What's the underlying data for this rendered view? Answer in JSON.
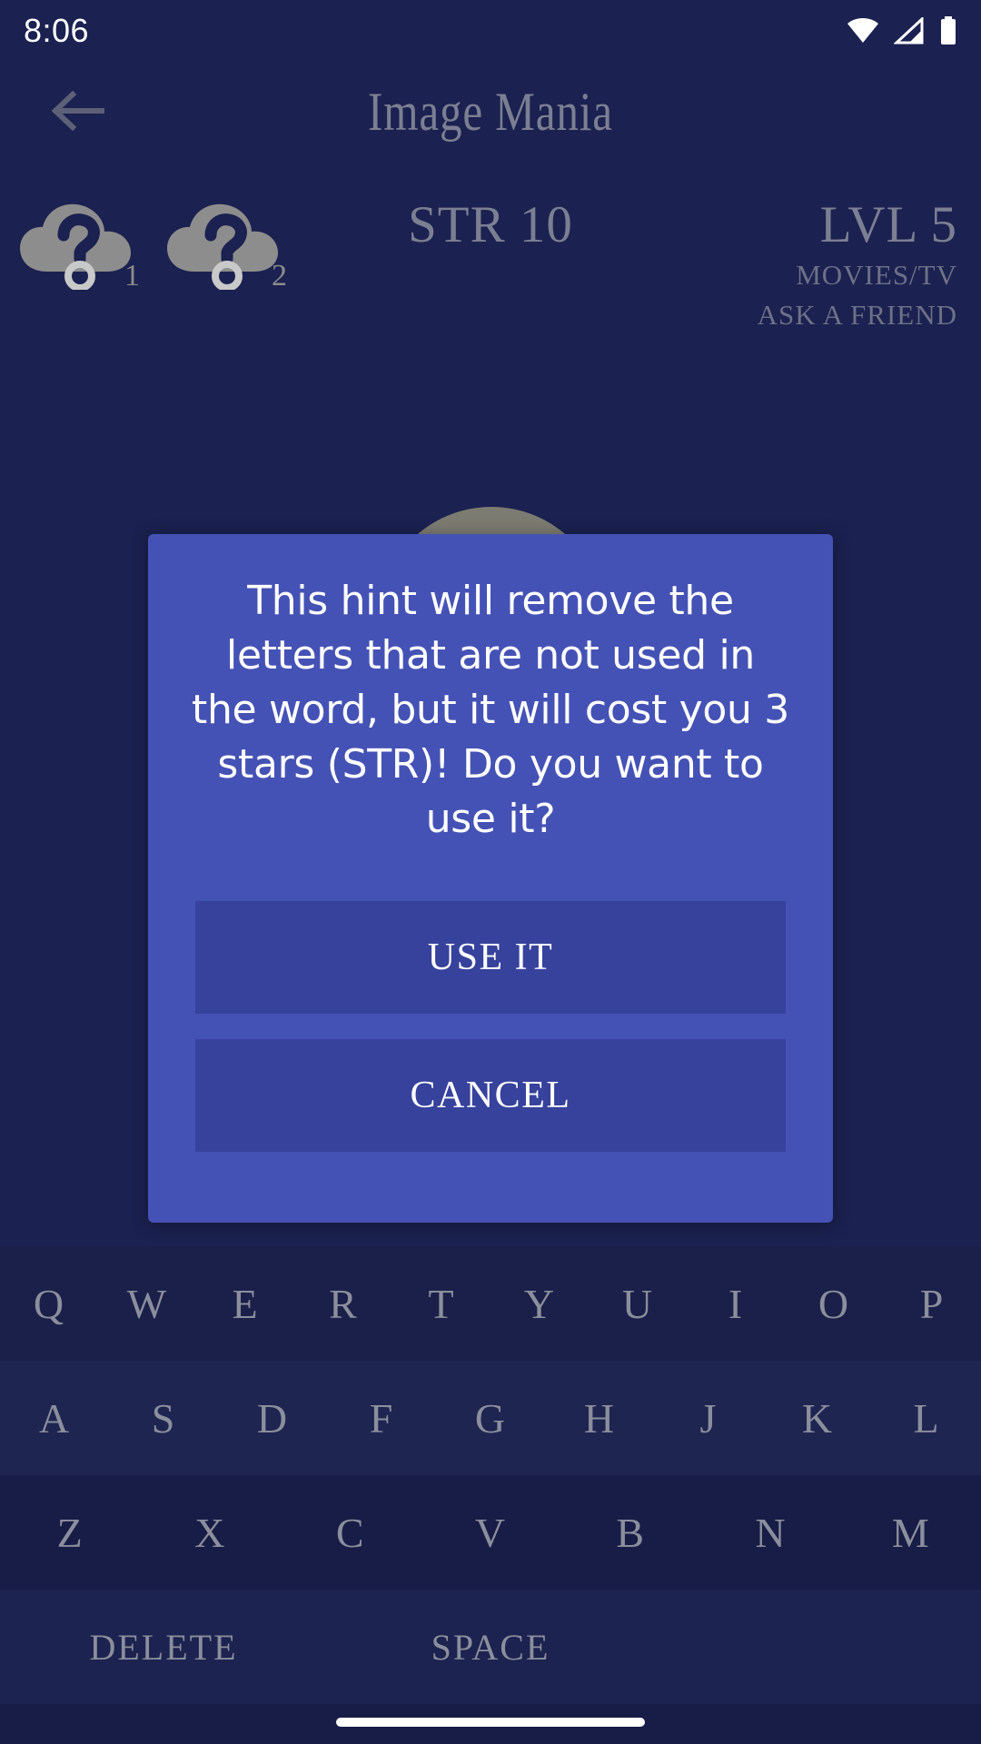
{
  "status_bar": {
    "time": "8:06",
    "icons": [
      "wifi-icon",
      "cellular-signal-icon",
      "battery-icon"
    ]
  },
  "app_bar": {
    "back_icon": "back-arrow-icon",
    "title": "Image Mania"
  },
  "stats": {
    "hints": [
      {
        "icon": "cloud-question-hint-icon",
        "count": "1"
      },
      {
        "icon": "cloud-question-hint-icon",
        "count": "2"
      }
    ],
    "strength": "STR 10",
    "level": "LVL 5",
    "category": "MOVIES/TV",
    "lifeline": "ASK A FRIEND"
  },
  "dialog": {
    "message": "This hint will remove the letters that are not used in the word, but it will cost you 3 stars (STR)! Do you want to use it?",
    "confirm_label": "USE IT",
    "cancel_label": "CANCEL"
  },
  "keyboard": {
    "row1": [
      "Q",
      "W",
      "E",
      "R",
      "T",
      "Y",
      "U",
      "I",
      "O",
      "P"
    ],
    "row2": [
      "A",
      "S",
      "D",
      "F",
      "G",
      "H",
      "J",
      "K",
      "L"
    ],
    "row3": [
      "Z",
      "X",
      "C",
      "V",
      "B",
      "N",
      "M"
    ],
    "row4": {
      "delete": "DELETE",
      "space": "SPACE"
    }
  },
  "colors": {
    "background": "#1b2150",
    "dialog": "#4552b5",
    "dialog_button": "#36429c",
    "dimmed_text": "#7b7f92",
    "keyboard_text": "#8b8e9c",
    "white": "#ffffff"
  }
}
